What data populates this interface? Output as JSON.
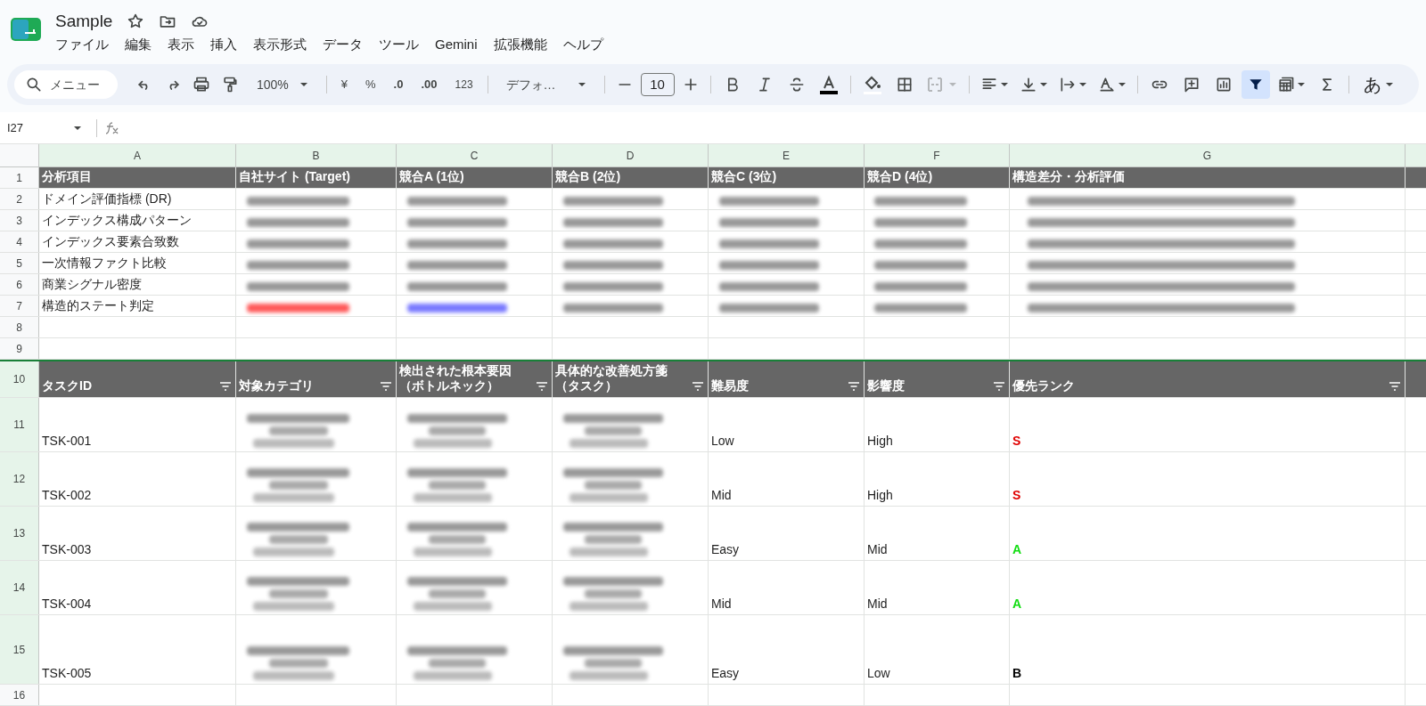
{
  "app": {
    "title": "Sample",
    "menu": [
      "ファイル",
      "編集",
      "表示",
      "挿入",
      "表示形式",
      "データ",
      "ツール",
      "Gemini",
      "拡張機能",
      "ヘルプ"
    ]
  },
  "toolbar": {
    "search_placeholder": "メニュー",
    "zoom": "100%",
    "currency": "¥",
    "percent": "%",
    "dec_decrease": ".0",
    "dec_increase": ".00",
    "number_format": "123",
    "font": "デフォ…",
    "font_size": "10",
    "filter_on": true,
    "ime": "あ"
  },
  "formula_bar": {
    "cell_ref": "I27"
  },
  "columns": [
    "A",
    "B",
    "C",
    "D",
    "E",
    "F",
    "G"
  ],
  "rows": [
    {
      "num": "1",
      "kind": "header",
      "cells": [
        {
          "text": "分析項目"
        },
        {
          "text": "自社サイト (Target)"
        },
        {
          "text": "競合A (1位)"
        },
        {
          "text": "競合B (2位)"
        },
        {
          "text": "競合C (3位)"
        },
        {
          "text": "競合D (4位)"
        },
        {
          "text": "構造差分・分析評価"
        }
      ]
    },
    {
      "num": "2",
      "kind": "data",
      "cells": [
        {
          "text": "ドメイン評価指標 (DR)"
        },
        {
          "redacted": true
        },
        {
          "redacted": true
        },
        {
          "redacted": true
        },
        {
          "redacted": true
        },
        {
          "redacted": true
        },
        {
          "redacted": true
        }
      ]
    },
    {
      "num": "3",
      "kind": "data",
      "cells": [
        {
          "text": "インデックス構成パターン"
        },
        {
          "redacted": true
        },
        {
          "redacted": true
        },
        {
          "redacted": true
        },
        {
          "redacted": true
        },
        {
          "redacted": true
        },
        {
          "redacted": true
        }
      ]
    },
    {
      "num": "4",
      "kind": "data",
      "cells": [
        {
          "text": "インデックス要素合致数"
        },
        {
          "redacted": true
        },
        {
          "redacted": true
        },
        {
          "redacted": true
        },
        {
          "redacted": true
        },
        {
          "redacted": true
        },
        {
          "redacted": true
        }
      ]
    },
    {
      "num": "5",
      "kind": "data",
      "cells": [
        {
          "text": "一次情報ファクト比較"
        },
        {
          "redacted": true
        },
        {
          "redacted": true
        },
        {
          "redacted": true
        },
        {
          "redacted": true
        },
        {
          "redacted": true
        },
        {
          "redacted": true
        }
      ]
    },
    {
      "num": "6",
      "kind": "data",
      "cells": [
        {
          "text": "商業シグナル密度"
        },
        {
          "redacted": true
        },
        {
          "redacted": true
        },
        {
          "redacted": true
        },
        {
          "redacted": true
        },
        {
          "redacted": true
        },
        {
          "redacted": true
        }
      ]
    },
    {
      "num": "7",
      "kind": "data",
      "cells": [
        {
          "text": "構造的ステート判定"
        },
        {
          "redacted": true,
          "color": "#ff5a5a"
        },
        {
          "redacted": true,
          "color": "#7a7aff"
        },
        {
          "redacted": true
        },
        {
          "redacted": true
        },
        {
          "redacted": true
        },
        {
          "redacted": true
        }
      ]
    },
    {
      "num": "8",
      "kind": "empty"
    },
    {
      "num": "9",
      "kind": "empty"
    },
    {
      "num": "10",
      "kind": "filter_header",
      "cells": [
        {
          "text": "タスクID"
        },
        {
          "text": "対象カテゴリ"
        },
        {
          "text": "検出された根本要因（ボトルネック）"
        },
        {
          "text": "具体的な改善処方箋（タスク）"
        },
        {
          "text": "難易度"
        },
        {
          "text": "影響度"
        },
        {
          "text": "優先ランク"
        }
      ]
    },
    {
      "num": "11",
      "kind": "data",
      "cells": [
        {
          "text": "TSK-001"
        },
        {
          "redacted": true
        },
        {
          "redacted": true
        },
        {
          "redacted": true
        },
        {
          "text": "Low"
        },
        {
          "text": "High"
        },
        {
          "text": "S",
          "color": "#e00000"
        }
      ]
    },
    {
      "num": "12",
      "kind": "data",
      "cells": [
        {
          "text": "TSK-002"
        },
        {
          "redacted": true
        },
        {
          "redacted": true
        },
        {
          "redacted": true
        },
        {
          "text": "Mid"
        },
        {
          "text": "High"
        },
        {
          "text": "S",
          "color": "#e00000"
        }
      ]
    },
    {
      "num": "13",
      "kind": "data",
      "cells": [
        {
          "text": "TSK-003"
        },
        {
          "redacted": true
        },
        {
          "redacted": true
        },
        {
          "redacted": true
        },
        {
          "text": "Easy"
        },
        {
          "text": "Mid"
        },
        {
          "text": "A",
          "color": "#11dd11"
        }
      ]
    },
    {
      "num": "14",
      "kind": "data",
      "cells": [
        {
          "text": "TSK-004"
        },
        {
          "redacted": true
        },
        {
          "redacted": true
        },
        {
          "redacted": true
        },
        {
          "text": "Mid"
        },
        {
          "text": "Mid"
        },
        {
          "text": "A",
          "color": "#11dd11"
        }
      ]
    },
    {
      "num": "15",
      "kind": "data",
      "cells": [
        {
          "text": "TSK-005"
        },
        {
          "redacted": true
        },
        {
          "redacted": true
        },
        {
          "redacted": true
        },
        {
          "text": "Easy"
        },
        {
          "text": "Low"
        },
        {
          "text": "B",
          "color": "#000000"
        }
      ]
    },
    {
      "num": "16",
      "kind": "empty"
    }
  ]
}
